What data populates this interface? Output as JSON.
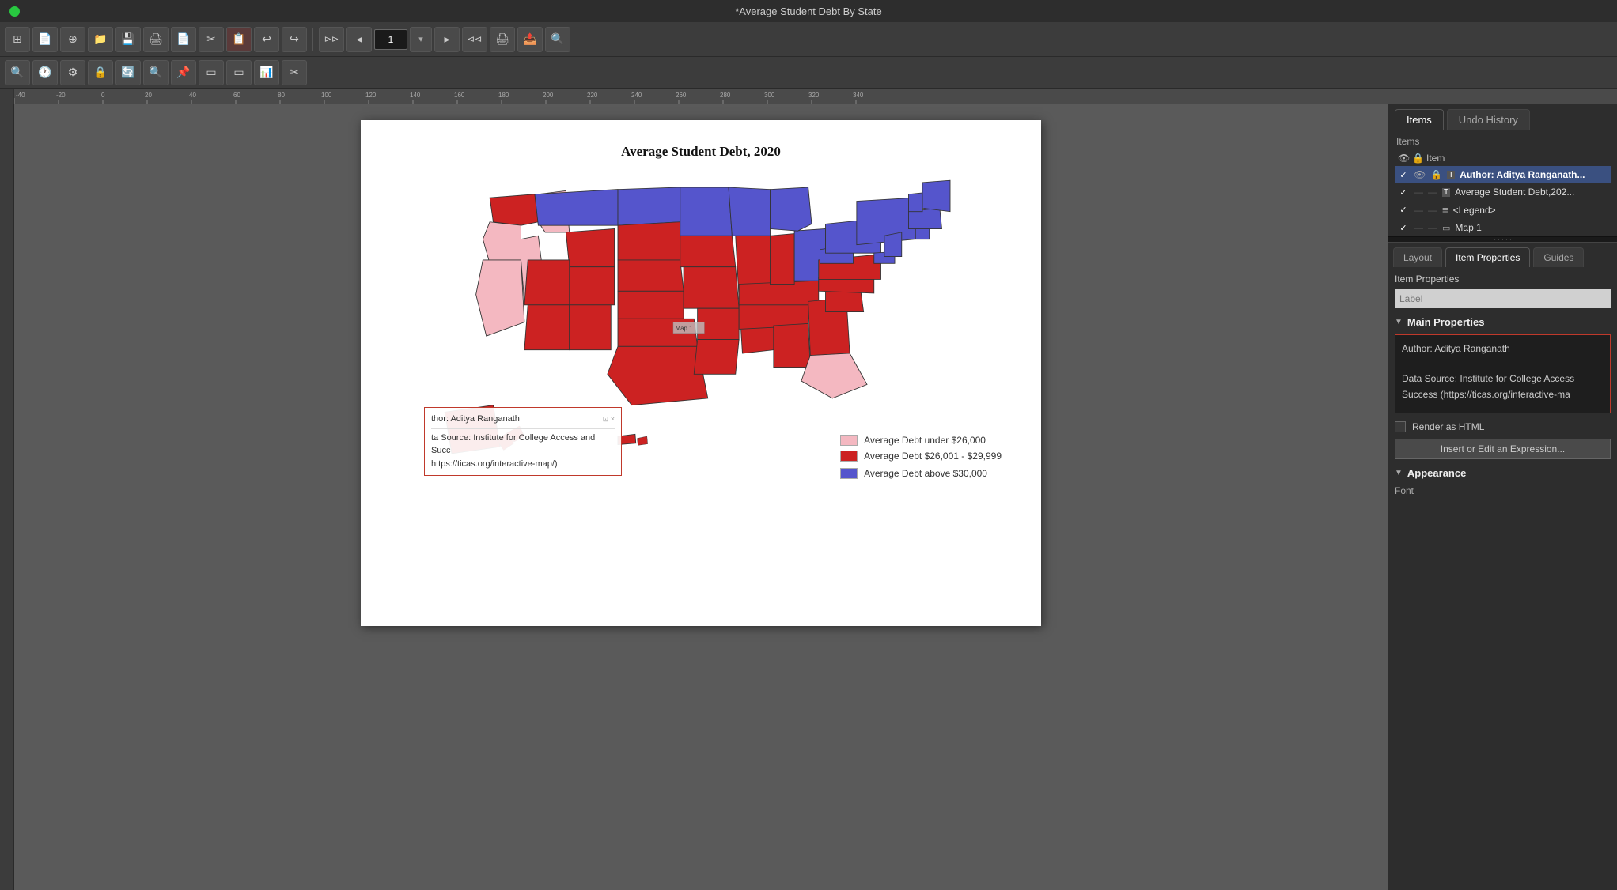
{
  "title_bar": {
    "title": "*Average Student Debt By State"
  },
  "toolbar1": {
    "buttons": [
      "⊞",
      "⬚",
      "⊕",
      "📁",
      "💾",
      "🖨",
      "📄",
      "✂",
      "↩",
      "↪",
      "▸",
      "◂",
      "➡",
      "⬅",
      "🖨",
      "🔍"
    ],
    "page_input": "1"
  },
  "toolbar2": {
    "buttons": [
      "🔍",
      "🕐",
      "⚙",
      "🔒",
      "🔄",
      "🔍",
      "📌",
      "▭",
      "▭",
      "📊",
      "✂"
    ]
  },
  "ruler": {
    "ticks": [
      "-40",
      "-20",
      "0",
      "20",
      "40",
      "60",
      "80",
      "100",
      "120",
      "140",
      "160",
      "180",
      "200",
      "220",
      "240",
      "260",
      "280",
      "300",
      "320",
      "340"
    ]
  },
  "map": {
    "title": "Average Student Debt, 2020",
    "label": "Map 1"
  },
  "legend": {
    "items": [
      {
        "color": "#f4b8c1",
        "label": "Average Debt under $26,000"
      },
      {
        "color": "#cc2222",
        "label": "Average Debt $26,001 - $29,999"
      },
      {
        "color": "#5555cc",
        "label": "Average Debt above $30,000"
      }
    ]
  },
  "author_box": {
    "line1": "thor: Aditya Ranganath",
    "line2": "ta Source: Institute for College Access and Succ",
    "line3": "https://ticas.org/interactive-map/)"
  },
  "right_panel": {
    "tabs": [
      "Items",
      "Undo History"
    ],
    "active_tab": "Items",
    "items_label": "Items",
    "header_col": "Item",
    "items": [
      {
        "check": "✓",
        "eye": true,
        "lock": true,
        "icon": "T",
        "name": "Author: Aditya Ranganath...",
        "bold": true
      },
      {
        "check": "✓",
        "eye": false,
        "lock": false,
        "icon": "T",
        "name": "Average Student Debt,202...",
        "bold": false
      },
      {
        "check": "✓",
        "eye": false,
        "lock": false,
        "icon": "≡",
        "name": "<Legend>",
        "bold": false
      },
      {
        "check": "✓",
        "eye": false,
        "lock": false,
        "icon": "▭",
        "name": "Map 1",
        "bold": false
      }
    ]
  },
  "bottom_panel": {
    "tabs": [
      "Layout",
      "Item Properties",
      "Guides"
    ],
    "active_tab": "Item Properties",
    "item_properties": {
      "title": "Item Properties",
      "label_placeholder": "Label",
      "label_value": "",
      "main_properties_title": "Main Properties",
      "content_line1": "Author: Aditya Ranganath",
      "content_line2": "",
      "content_line3": "Data Source: Institute for College Access",
      "content_line4": "Success (https://ticas.org/interactive-ma",
      "render_html_label": "Render as HTML",
      "insert_expr_btn": "Insert or Edit an Expression...",
      "appearance_title": "Appearance",
      "font_label": "Font"
    }
  },
  "colors": {
    "accent_red": "#c0392b",
    "panel_bg": "#2d2d2d",
    "toolbar_bg": "#3c3c3c",
    "active_tab": "#2d2d2d"
  }
}
